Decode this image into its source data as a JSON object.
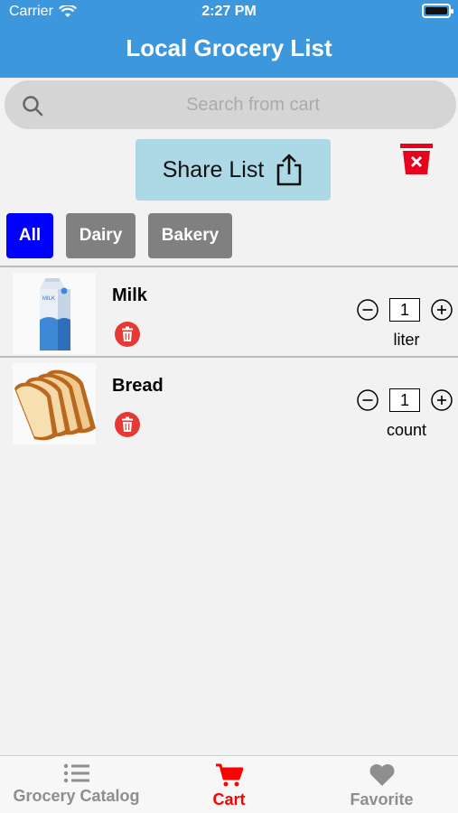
{
  "status": {
    "carrier": "Carrier",
    "time": "2:27 PM"
  },
  "header": {
    "title": "Local Grocery List"
  },
  "search": {
    "placeholder": "Search from cart"
  },
  "actions": {
    "share_label": "Share List"
  },
  "filters": [
    {
      "label": "All",
      "active": true
    },
    {
      "label": "Dairy",
      "active": false
    },
    {
      "label": "Bakery",
      "active": false
    }
  ],
  "items": [
    {
      "name": "Milk",
      "quantity": "1",
      "unit": "liter",
      "image": "milk-carton"
    },
    {
      "name": "Bread",
      "quantity": "1",
      "unit": "count",
      "image": "sliced-bread"
    }
  ],
  "tabs": [
    {
      "label": "Grocery Catalog",
      "icon": "list-icon",
      "active": false
    },
    {
      "label": "Cart",
      "icon": "cart-icon",
      "active": true
    },
    {
      "label": "Favorite",
      "icon": "heart-icon",
      "active": false
    }
  ],
  "colors": {
    "header": "#3d97dc",
    "active_filter": "#0000ff",
    "inactive_filter": "#808080",
    "delete": "#e53935",
    "active_tab": "#ff0000"
  }
}
